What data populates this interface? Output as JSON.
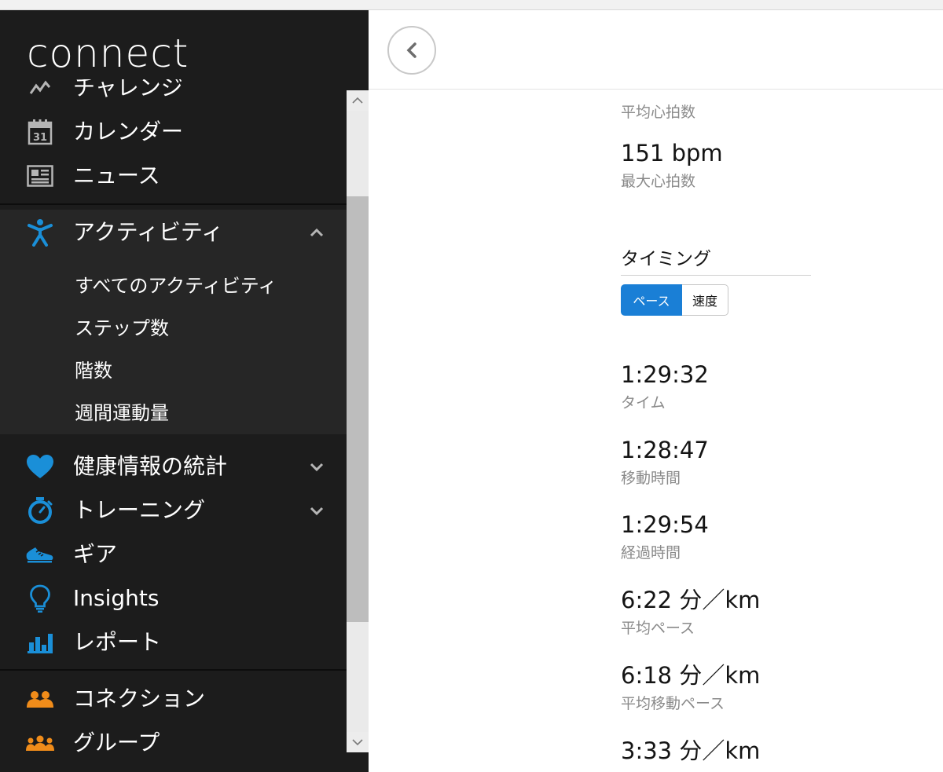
{
  "app": {
    "logo": "connect"
  },
  "sidebar": {
    "items": [
      {
        "label": "チャレンジ",
        "icon": "challenge-icon"
      },
      {
        "label": "カレンダー",
        "icon": "calendar-icon",
        "calendar_day": "31"
      },
      {
        "label": "ニュース",
        "icon": "news-icon"
      },
      {
        "label": "アクティビティ",
        "icon": "activity-person-icon",
        "expanded": true
      },
      {
        "label": "健康情報の統計",
        "icon": "heart-icon",
        "expanded": false
      },
      {
        "label": "トレーニング",
        "icon": "stopwatch-icon",
        "expanded": false
      },
      {
        "label": "ギア",
        "icon": "shoe-icon"
      },
      {
        "label": "Insights",
        "icon": "lightbulb-icon"
      },
      {
        "label": "レポート",
        "icon": "bar-chart-icon"
      },
      {
        "label": "コネクション",
        "icon": "connections-icon"
      },
      {
        "label": "グループ",
        "icon": "groups-icon"
      }
    ],
    "activity_sub": [
      "すべてのアクティビティ",
      "ステップ数",
      "階数",
      "週間運動量"
    ]
  },
  "colors": {
    "sidebar_bg": "#1c1c1c",
    "submenu_bg": "#262626",
    "accent_blue": "#1a8fd8",
    "accent_orange": "#f08c1a",
    "toggle_active": "#1a7fd6"
  },
  "main": {
    "back_icon": "chevron-left-icon",
    "hr_stats": [
      {
        "value": "",
        "caption": "平均心拍数"
      },
      {
        "value": "151 bpm",
        "caption": "最大心拍数"
      }
    ],
    "timing": {
      "title": "タイミング",
      "toggle": {
        "active": "ペース",
        "inactive": "速度"
      },
      "stats": [
        {
          "value": "1:29:32",
          "caption": "タイム"
        },
        {
          "value": "1:28:47",
          "caption": "移動時間"
        },
        {
          "value": "1:29:54",
          "caption": "経過時間"
        },
        {
          "value": "6:22 分／km",
          "caption": "平均ペース"
        },
        {
          "value": "6:18 分／km",
          "caption": "平均移動ペース"
        },
        {
          "value": "3:33 分／km",
          "caption": ""
        }
      ]
    }
  }
}
